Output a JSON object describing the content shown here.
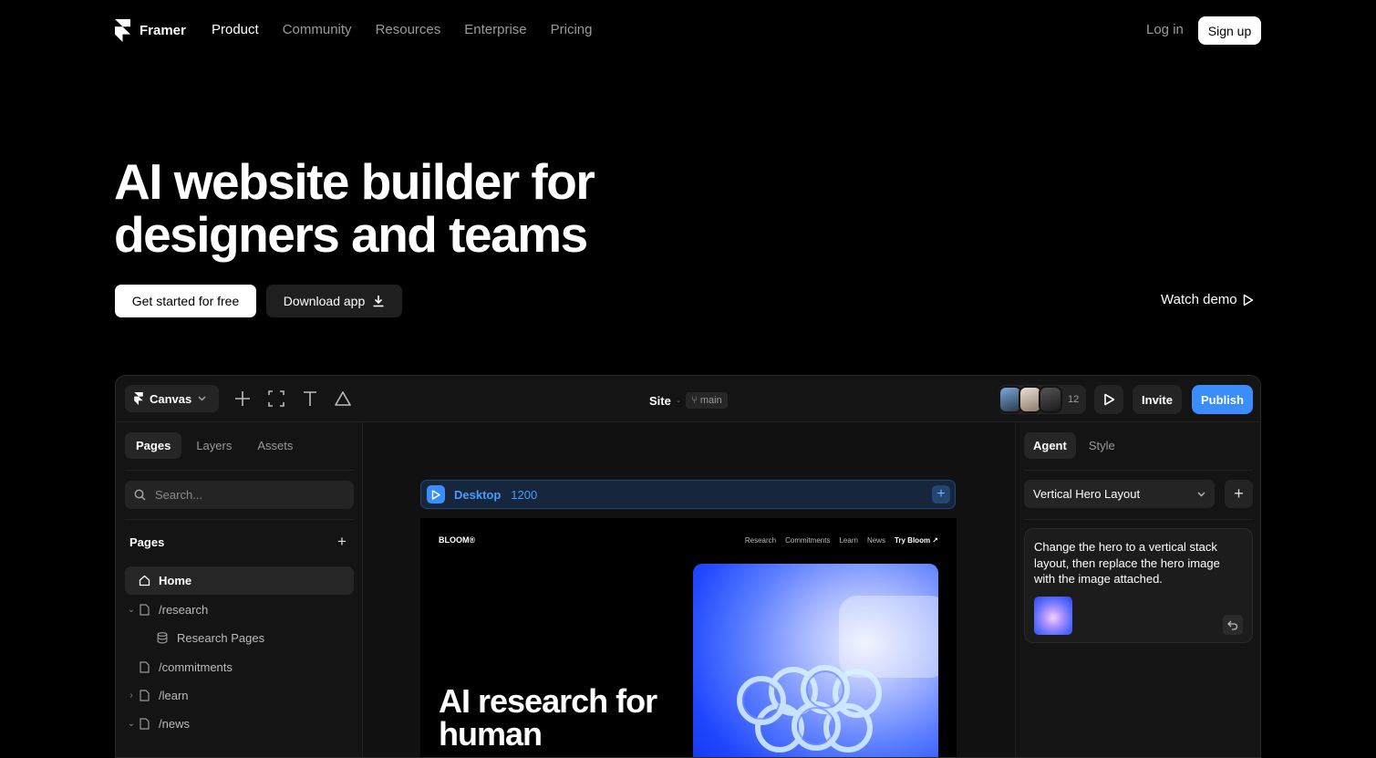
{
  "nav": {
    "brand": "Framer",
    "links": [
      "Product",
      "Community",
      "Resources",
      "Enterprise",
      "Pricing"
    ],
    "login": "Log in",
    "signup": "Sign up"
  },
  "hero": {
    "title_line1": "AI website builder for",
    "title_line2": "designers and teams",
    "primary_cta": "Get started for free",
    "secondary_cta": "Download app",
    "watch_demo": "Watch demo"
  },
  "app": {
    "toolbar": {
      "mode": "Canvas",
      "site_label": "Site",
      "separator": "·",
      "branch": "main",
      "collaborator_count": "12",
      "invite": "Invite",
      "publish": "Publish"
    },
    "left_panel": {
      "tabs": [
        "Pages",
        "Layers",
        "Assets"
      ],
      "search_placeholder": "Search...",
      "section_title": "Pages",
      "pages": [
        {
          "label": "Home",
          "icon": "home-icon",
          "chevron": ""
        },
        {
          "label": "/research",
          "icon": "page-icon",
          "chevron": "⌄"
        },
        {
          "label": "Research Pages",
          "icon": "database-icon",
          "chevron": ""
        },
        {
          "label": "/commitments",
          "icon": "page-icon",
          "chevron": ""
        },
        {
          "label": "/learn",
          "icon": "page-icon",
          "chevron": "›"
        },
        {
          "label": "/news",
          "icon": "page-icon",
          "chevron": "⌄"
        }
      ]
    },
    "canvas": {
      "device_name": "Desktop",
      "device_width": "1200",
      "preview": {
        "logo": "BLOOM®",
        "nav": [
          "Research",
          "Commitments",
          "Learn",
          "News"
        ],
        "nav_cta": "Try Bloom ↗",
        "title": "AI research for human"
      }
    },
    "right_panel": {
      "tabs": [
        "Agent",
        "Style"
      ],
      "selected_layout": "Vertical Hero Layout",
      "message": "Change the hero to a vertical stack layout, then replace the hero image with the image attached."
    }
  },
  "colors": {
    "background": "#000000",
    "accent_blue": "#3a8dfb",
    "panel": "#141414"
  }
}
